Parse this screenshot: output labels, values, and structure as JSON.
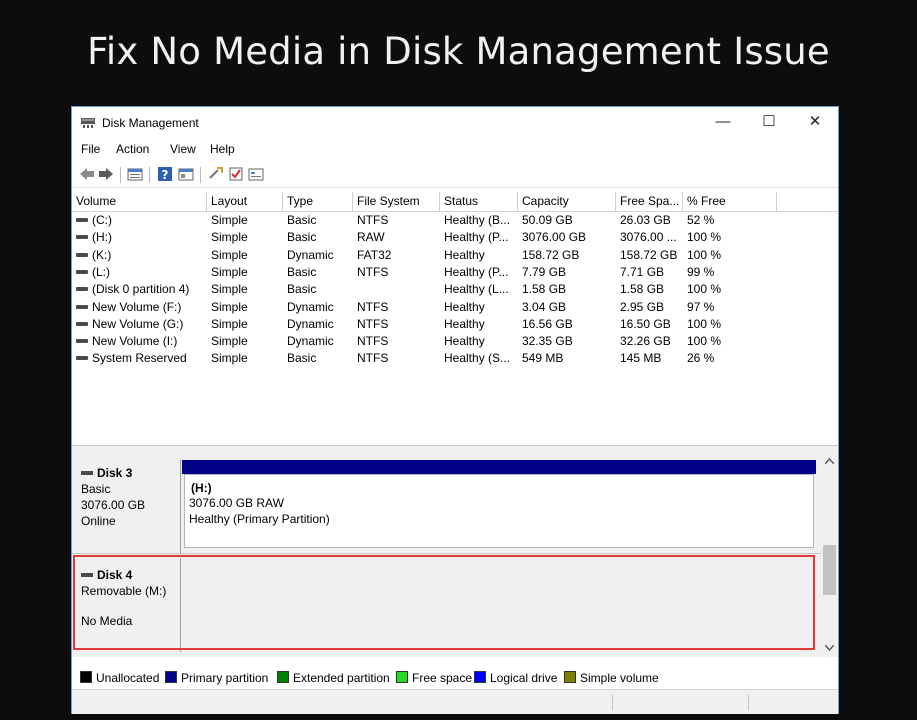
{
  "headline": "Fix No Media in Disk Management Issue",
  "window": {
    "title": "Disk Management",
    "controls": {
      "minimize": "—",
      "maximize": "☐",
      "close": "✕"
    }
  },
  "menu": [
    "File",
    "Action",
    "View",
    "Help"
  ],
  "toolbar_icons": [
    "back-arrow-icon",
    "forward-arrow-icon",
    "disk-list-icon",
    "help-icon",
    "properties-icon",
    "rescan-icon",
    "check-icon",
    "settings-icon"
  ],
  "columns": [
    "Volume",
    "Layout",
    "Type",
    "File System",
    "Status",
    "Capacity",
    "Free Spa...",
    "% Free"
  ],
  "volumes": [
    [
      "(C:)",
      "Simple",
      "Basic",
      "NTFS",
      "Healthy (B...",
      "50.09 GB",
      "26.03 GB",
      "52 %"
    ],
    [
      "(H:)",
      "Simple",
      "Basic",
      "RAW",
      "Healthy (P...",
      "3076.00 GB",
      "3076.00 ...",
      "100 %"
    ],
    [
      "(K:)",
      "Simple",
      "Dynamic",
      "FAT32",
      "Healthy",
      "158.72 GB",
      "158.72 GB",
      "100 %"
    ],
    [
      "(L:)",
      "Simple",
      "Basic",
      "NTFS",
      "Healthy (P...",
      "7.79 GB",
      "7.71 GB",
      "99 %"
    ],
    [
      "(Disk 0 partition 4)",
      "Simple",
      "Basic",
      "",
      "Healthy (L...",
      "1.58 GB",
      "1.58 GB",
      "100 %"
    ],
    [
      "New Volume (F:)",
      "Simple",
      "Dynamic",
      "NTFS",
      "Healthy",
      "3.04 GB",
      "2.95 GB",
      "97 %"
    ],
    [
      "New Volume (G:)",
      "Simple",
      "Dynamic",
      "NTFS",
      "Healthy",
      "16.56 GB",
      "16.50 GB",
      "100 %"
    ],
    [
      "New Volume (I:)",
      "Simple",
      "Dynamic",
      "NTFS",
      "Healthy",
      "32.35 GB",
      "32.26 GB",
      "100 %"
    ],
    [
      "System Reserved",
      "Simple",
      "Basic",
      "NTFS",
      "Healthy (S...",
      "549 MB",
      "145 MB",
      "26 %"
    ]
  ],
  "disk3": {
    "name": "Disk 3",
    "type": "Basic",
    "size": "3076.00 GB",
    "state": "Online",
    "partition": {
      "label": "(H:)",
      "detail": "3076.00 GB RAW",
      "status": "Healthy (Primary Partition)"
    }
  },
  "disk4": {
    "name": "Disk 4",
    "type": "Removable (M:)",
    "state": "No Media"
  },
  "legend": [
    {
      "label": "Unallocated",
      "color": "#000000"
    },
    {
      "label": "Primary partition",
      "color": "#00008b"
    },
    {
      "label": "Extended partition",
      "color": "#008000"
    },
    {
      "label": "Free space",
      "color": "#22dd22"
    },
    {
      "label": "Logical drive",
      "color": "#0000ff"
    },
    {
      "label": "Simple volume",
      "color": "#808000"
    }
  ],
  "colors": {
    "highlight": "#e03a3a",
    "primary_bar": "#00008b",
    "window_border": "#6aa0d8"
  }
}
